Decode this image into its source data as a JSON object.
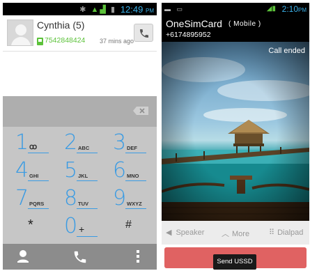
{
  "left": {
    "status": {
      "time": "12:49",
      "ampm": "PM"
    },
    "contact": {
      "name": "Cynthia (5)",
      "number": "7542848424",
      "ago": "37 mins ago"
    },
    "keys": [
      {
        "num": "1",
        "letters": "ꝏ"
      },
      {
        "num": "2",
        "letters": "ABC"
      },
      {
        "num": "3",
        "letters": "DEF"
      },
      {
        "num": "4",
        "letters": "GHI"
      },
      {
        "num": "5",
        "letters": "JKL"
      },
      {
        "num": "6",
        "letters": "MNO"
      },
      {
        "num": "7",
        "letters": "PQRS"
      },
      {
        "num": "8",
        "letters": "TUV"
      },
      {
        "num": "9",
        "letters": "WXYZ"
      },
      {
        "num": "",
        "letters": "*"
      },
      {
        "num": "0",
        "letters": "+"
      },
      {
        "num": "",
        "letters": "#"
      }
    ]
  },
  "right": {
    "status": {
      "time": "2:10",
      "ampm": "PM"
    },
    "caller": "OneSimCard",
    "caller_type": "( Mobile )",
    "caller_number": "+6174895952",
    "call_state": "Call ended",
    "controls": {
      "speaker": "Speaker",
      "more": "More",
      "dialpad": "Dialpad"
    },
    "toast": "Send USSD"
  },
  "colors": {
    "accent": "#3a9be3",
    "green": "#5cc23a",
    "end_call": "#e06262"
  }
}
